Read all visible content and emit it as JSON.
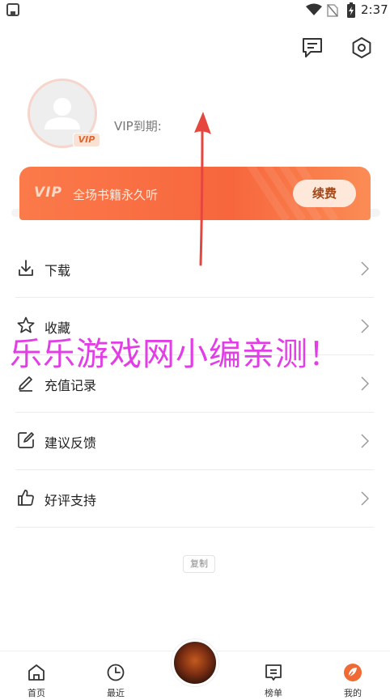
{
  "status_bar": {
    "time": "2:37",
    "icons": [
      "app-notification-icon",
      "wifi-icon",
      "no-sim-icon",
      "battery-charging-icon"
    ]
  },
  "header": {
    "icons": [
      "message-icon",
      "settings-icon"
    ]
  },
  "profile": {
    "vip_badge": "VIP",
    "vip_expire_label": "VIP到期:"
  },
  "vip_card": {
    "logo": "VIP",
    "slogan": "全场书籍永久听",
    "renew_label": "续费"
  },
  "menu": {
    "items": [
      {
        "label": "下载",
        "icon": "download-icon"
      },
      {
        "label": "收藏",
        "icon": "star-icon"
      },
      {
        "label": "充值记录",
        "icon": "edit-icon"
      },
      {
        "label": "建议反馈",
        "icon": "feedback-icon"
      },
      {
        "label": "好评支持",
        "icon": "thumbs-up-icon"
      }
    ]
  },
  "copy_label": "复制",
  "watermark": "乐乐游戏网小编亲测！",
  "tab_bar": {
    "tabs": [
      {
        "label": "首页",
        "icon": "home-icon"
      },
      {
        "label": "最近",
        "icon": "clock-icon"
      },
      {
        "label": "",
        "icon": "center-cover-icon"
      },
      {
        "label": "榜单",
        "icon": "ranking-icon"
      },
      {
        "label": "我的",
        "icon": "profile-icon"
      }
    ],
    "active_color": "#f06a35"
  },
  "colors": {
    "accent": "#f7663d",
    "arrow": "#e5473f",
    "watermark": "#e23ee6"
  }
}
